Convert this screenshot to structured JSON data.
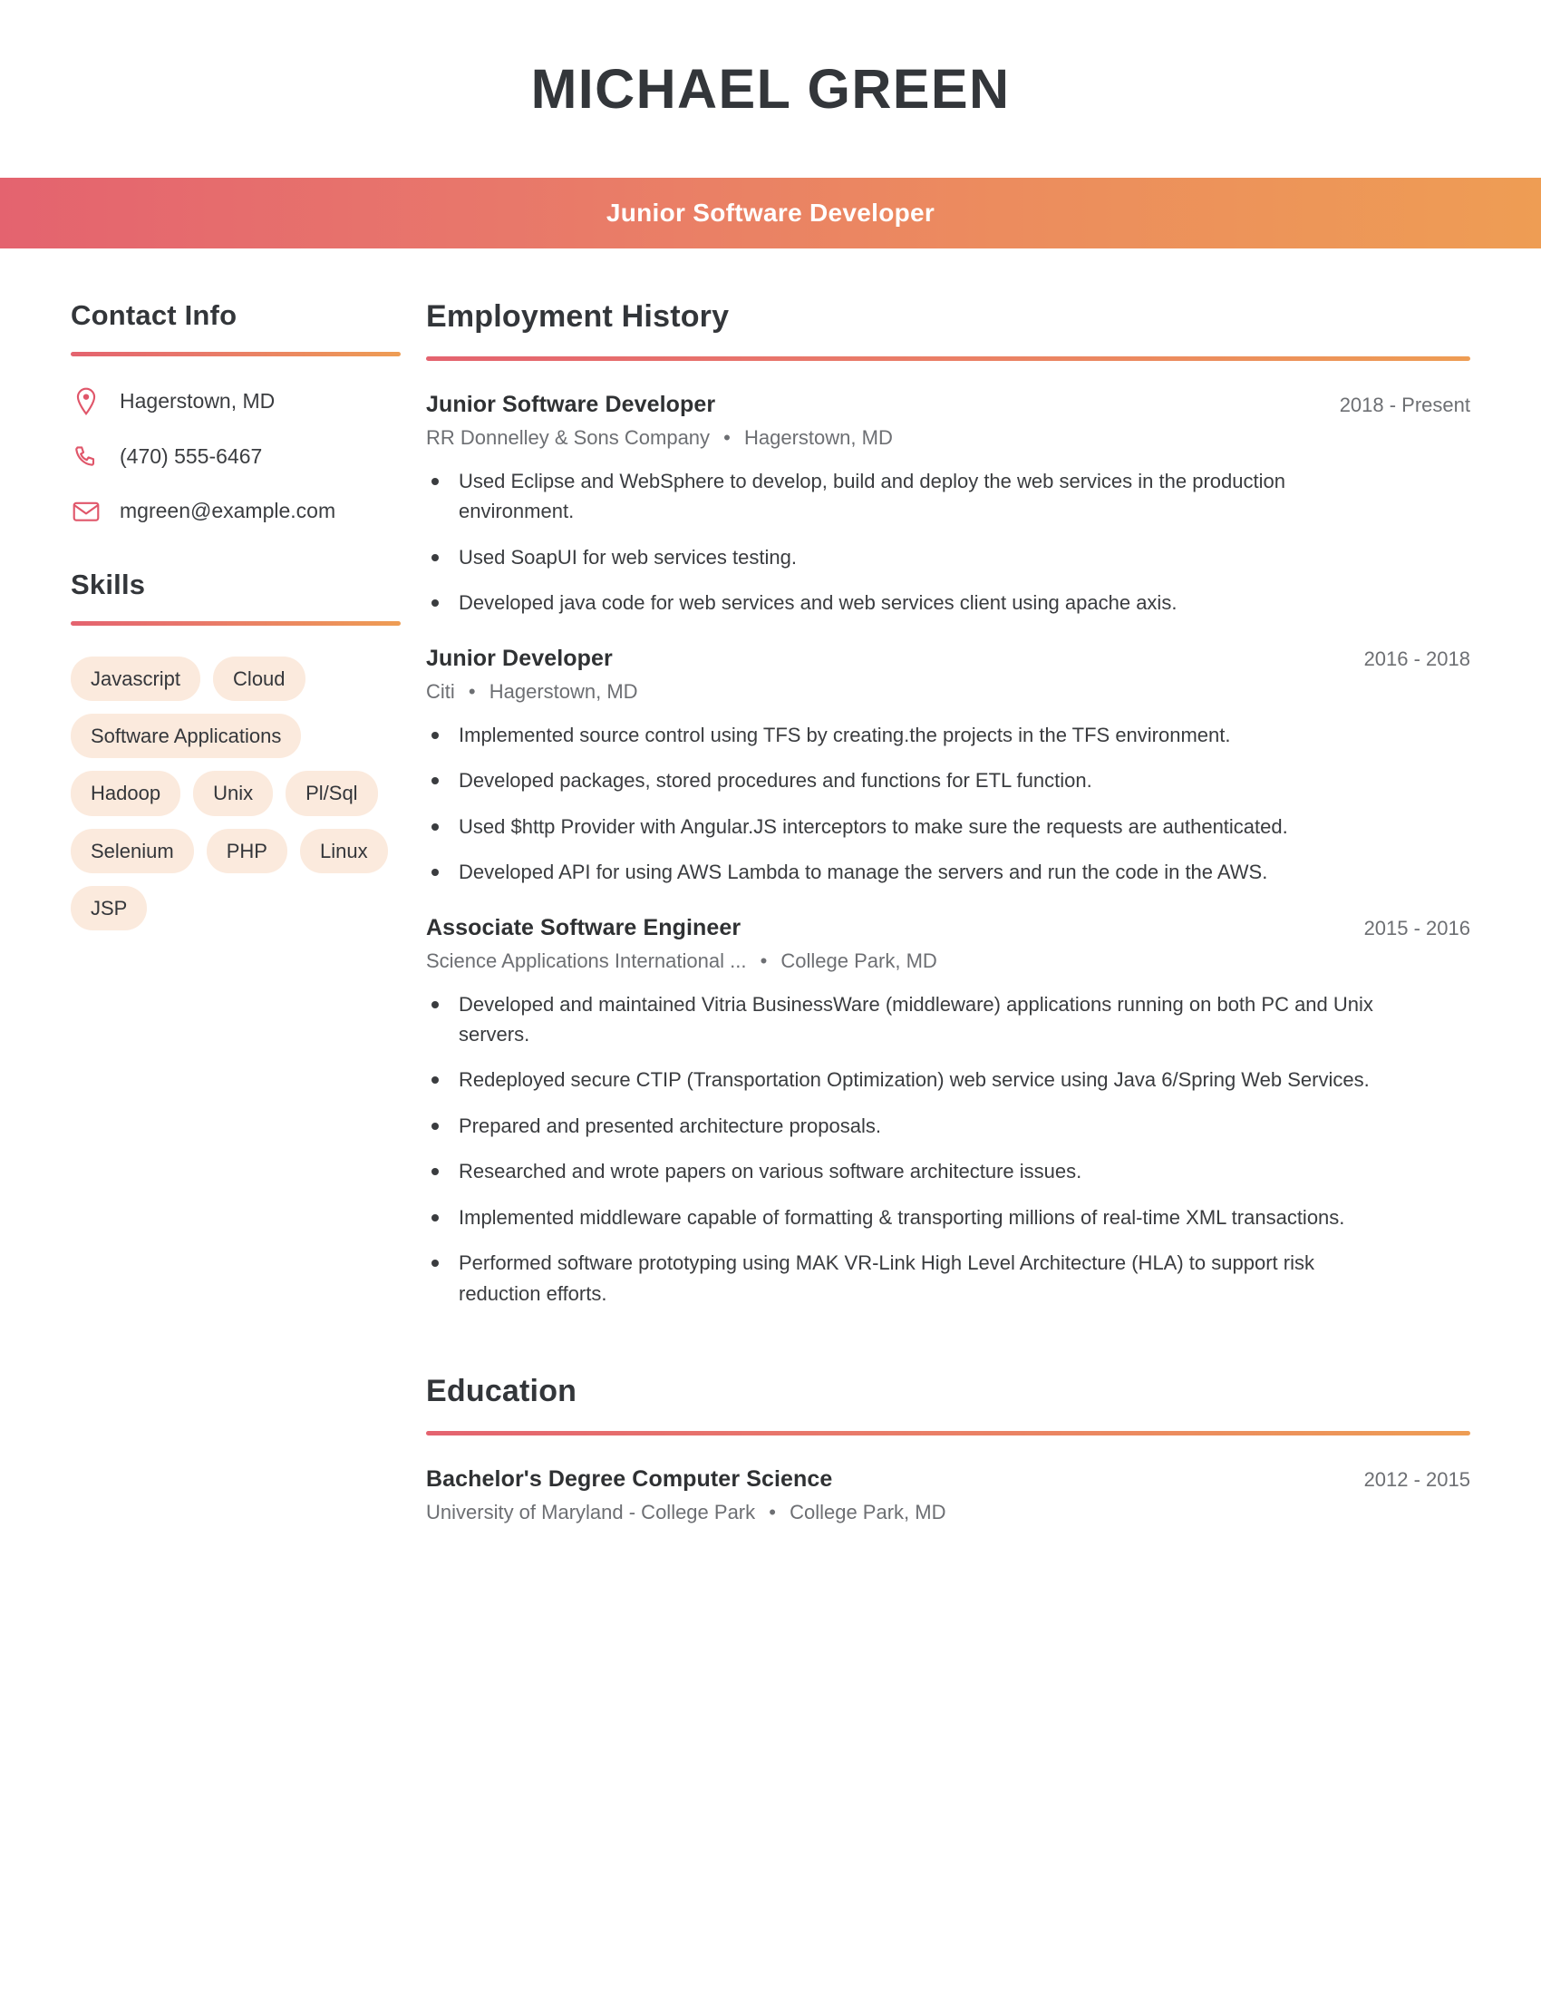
{
  "header": {
    "full_name": "MICHAEL GREEN",
    "job_title": "Junior Software Developer",
    "gradient_start": "#e4636f",
    "gradient_end": "#ee9d54"
  },
  "sidebar": {
    "contact": {
      "heading": "Contact Info",
      "items": [
        {
          "icon": "map-pin-icon",
          "value": "Hagerstown, MD"
        },
        {
          "icon": "phone-icon",
          "value": "(470) 555-6467"
        },
        {
          "icon": "envelope-icon",
          "value": "mgreen@example.com"
        }
      ]
    },
    "skills": {
      "heading": "Skills",
      "tag_bg": "#fbeadd",
      "items": [
        "Javascript",
        "Cloud",
        "Software Applications",
        "Hadoop",
        "Unix",
        "Pl/Sql",
        "Selenium",
        "PHP",
        "Linux",
        "JSP"
      ]
    }
  },
  "employment": {
    "heading": "Employment History",
    "entries": [
      {
        "role": "Junior Software Developer",
        "dates": "2018 - Present",
        "company": "RR Donnelley & Sons Company",
        "location": "Hagerstown, MD",
        "bullets": [
          "Used Eclipse and WebSphere to develop, build and deploy the web services in the production environment.",
          "Used SoapUI for web services testing.",
          "Developed java code for web services and web services client using apache axis."
        ]
      },
      {
        "role": "Junior Developer",
        "dates": "2016 - 2018",
        "company": "Citi",
        "location": "Hagerstown, MD",
        "bullets": [
          "Implemented source control using TFS by creating.the projects in the TFS environment.",
          "Developed packages, stored procedures and functions for ETL function.",
          "Used $http Provider with Angular.JS interceptors to make sure the requests are authenticated.",
          "Developed API for using AWS Lambda to manage the servers and run the code in the AWS."
        ]
      },
      {
        "role": "Associate Software Engineer",
        "dates": "2015 - 2016",
        "company": "Science Applications International ...",
        "location": "College Park, MD",
        "bullets": [
          "Developed and maintained Vitria BusinessWare (middleware) applications running on both PC and Unix servers.",
          "Redeployed secure CTIP (Transportation Optimization) web service using Java 6/Spring Web Services.",
          "Prepared and presented architecture proposals.",
          "Researched and wrote papers on various software architecture issues.",
          "Implemented middleware capable of formatting & transporting millions of real-time XML transactions.",
          "Performed software prototyping using MAK VR-Link High Level Architecture (HLA) to support risk reduction efforts."
        ]
      }
    ]
  },
  "education": {
    "heading": "Education",
    "entries": [
      {
        "degree": "Bachelor's Degree Computer Science",
        "dates": "2012 - 2015",
        "school": "University of Maryland - College Park",
        "location": "College Park, MD"
      }
    ]
  },
  "separator": "•"
}
